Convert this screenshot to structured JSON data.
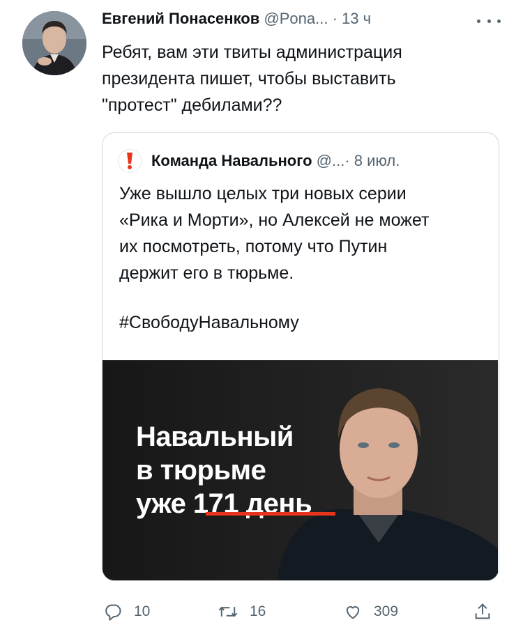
{
  "tweet": {
    "author_name": "Евгений Понасенков",
    "author_handle": "@Pona...",
    "time": " · 13 ч",
    "text_lines": [
      "Ребят, вам эти твиты администрация",
      "президента пишет, чтобы выставить",
      "\"протест\" дебилами??"
    ]
  },
  "quote": {
    "author_name": "Команда Навального",
    "author_handle": "@...",
    "date": " · 8 июл.",
    "text_lines": [
      "Уже вышло целых три новых серии",
      "«Рика и Морти», но Алексей не может",
      "их посмотреть, потому что Путин",
      "держит его в тюрьме."
    ],
    "hashtag": "#СвободуНавальному",
    "media": {
      "lines": [
        "Навальный",
        "в тюрьме",
        "уже 171 день"
      ],
      "accent_color": "#e8341c"
    }
  },
  "actions": {
    "reply_count": "10",
    "retweet_count": "16",
    "like_count": "309"
  }
}
